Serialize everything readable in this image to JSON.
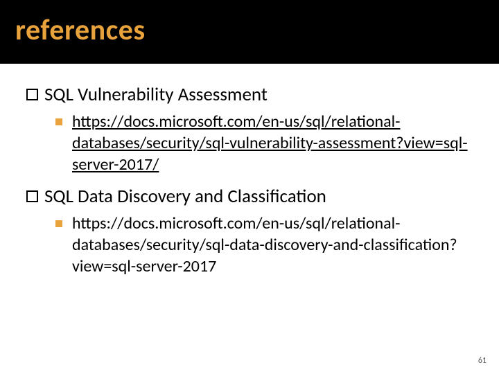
{
  "title": "references",
  "items": [
    {
      "heading": "SQL Vulnerability Assessment",
      "link": "https://docs.microsoft.com/en-us/sql/relational-databases/security/sql-vulnerability-assessment?view=sql-server-2017/",
      "linked": true
    },
    {
      "heading": "SQL Data Discovery and Classification",
      "link": "https://docs.microsoft.com/en-us/sql/relational-databases/security/sql-data-discovery-and-classification?view=sql-server-2017",
      "linked": false
    }
  ],
  "slide_number": "61"
}
